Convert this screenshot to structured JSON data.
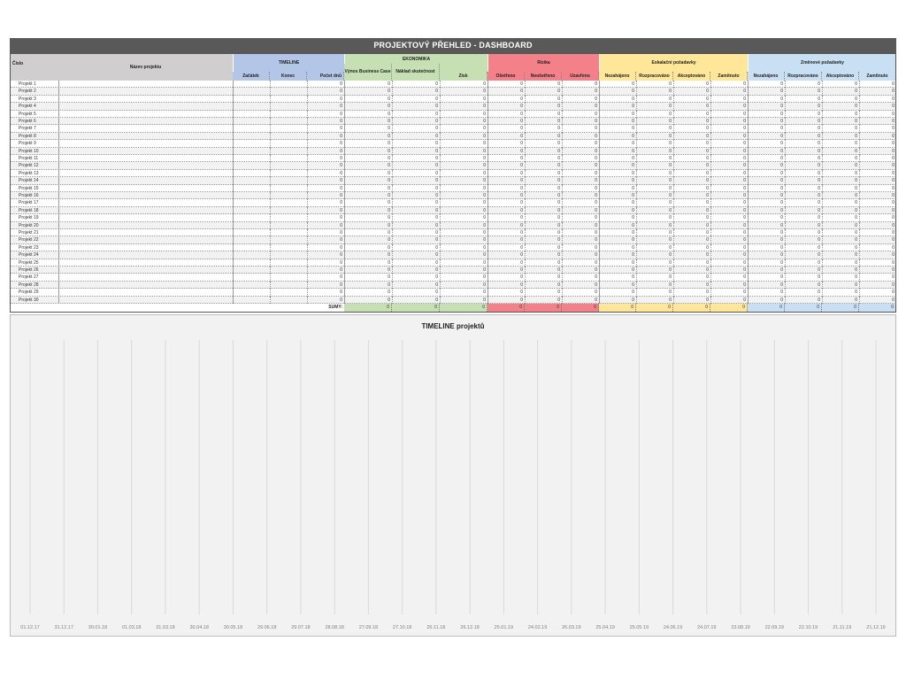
{
  "dashboard": {
    "title": "PROJEKTOVÝ PŘEHLED - DASHBOARD",
    "col_cislo": "Číslo",
    "col_nazev": "Název projektu",
    "groups": {
      "timeline": {
        "label": "TIMELINE",
        "color": "#b4c6e7",
        "subs": [
          "Začátek",
          "Konec",
          "Počet dnů"
        ]
      },
      "ekonomika": {
        "label": "EKONOMIKA",
        "color": "#c6e0b4",
        "subs": [
          "Výnos Business Case",
          "Náklad skutečnost",
          "Zisk"
        ]
      },
      "rizika": {
        "label": "Rizika",
        "color": "#f4808a",
        "subs": [
          "Ošetřeno",
          "Neošetřeno",
          "Uzavřeno"
        ]
      },
      "eskalacni": {
        "label": "Eskalační požadavky",
        "color": "#ffe699",
        "subs": [
          "Nezahájeno",
          "Rozpracováno",
          "Akceptováno",
          "Zamítnuto"
        ]
      },
      "zmenove": {
        "label": "Změnové požadavky",
        "color": "#c9dff3",
        "subs": [
          "Nezahájeno",
          "Rozpracováno",
          "Akceptováno",
          "Zamítnuto"
        ]
      }
    },
    "projects": [
      "Projekt 1",
      "Projekt 2",
      "Projekt 3",
      "Projekt 4",
      "Projekt 5",
      "Projekt 6",
      "Projekt 7",
      "Projekt 8",
      "Projekt 9",
      "Projekt 10",
      "Projekt 11",
      "Projekt 12",
      "Projekt 13",
      "Projekt 14",
      "Projekt 15",
      "Projekt 16",
      "Projekt 17",
      "Projekt 18",
      "Projekt 19",
      "Projekt 20",
      "Projekt 21",
      "Projekt 22",
      "Projekt 23",
      "Projekt 24",
      "Projekt 25",
      "Projekt 26",
      "Projekt 27",
      "Projekt 28",
      "Projekt 29",
      "Projekt 30"
    ],
    "cell_value": "0",
    "sum_label": "SUMY:"
  },
  "chart_data": {
    "type": "bar",
    "title": "TIMELINE projektů",
    "x": [
      "01.12.17",
      "31.12.17",
      "30.01.18",
      "01.03.18",
      "31.03.18",
      "30.04.18",
      "30.05.18",
      "29.06.18",
      "29.07.18",
      "28.08.18",
      "27.09.18",
      "27.10.18",
      "26.11.18",
      "26.12.18",
      "25.01.19",
      "24.02.19",
      "26.03.19",
      "25.04.19",
      "25.05.19",
      "24.06.19",
      "24.07.19",
      "23.08.19",
      "22.09.19",
      "22.10.19",
      "21.11.19",
      "21.12.19"
    ],
    "series": [],
    "grid": true
  }
}
